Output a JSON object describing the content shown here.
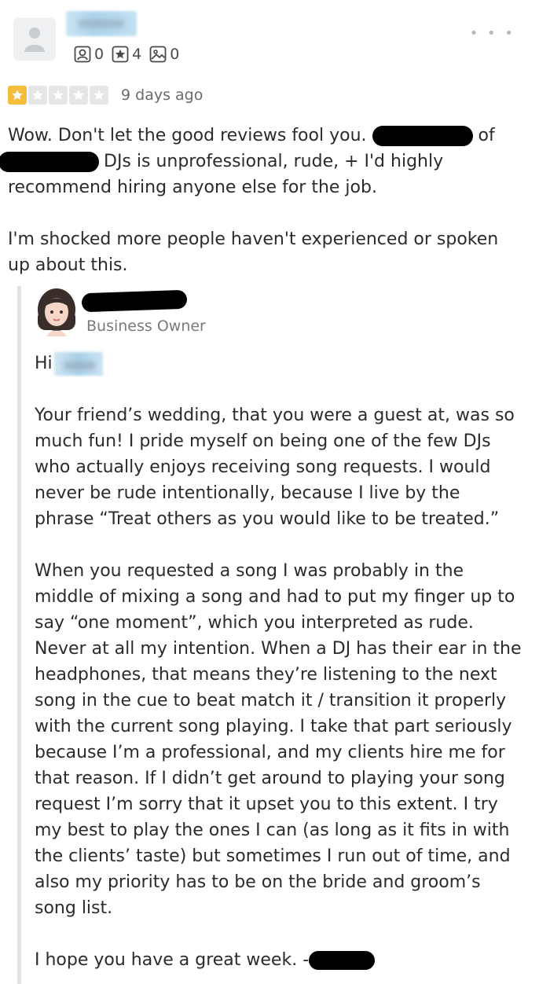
{
  "reviewer": {
    "stats": {
      "friends": "0",
      "reviews": "4",
      "photos": "0"
    },
    "more_menu": "• • •"
  },
  "review": {
    "rating": 1,
    "max_rating": 5,
    "date": "9 days ago",
    "line1a": "Wow. Don't let the good reviews fool you.",
    "line1b": "of",
    "line2": "DJs is unprofessional, rude, + I'd highly",
    "line3": "recommend hiring anyone else for the job.",
    "para2_line1": "I'm shocked more people haven't experienced or spoken",
    "para2_line2": "up about this."
  },
  "owner": {
    "role": "Business Owner",
    "greeting": "Hi",
    "para1": [
      "Your friend’s wedding, that you were a guest at, was so",
      "much fun! I pride myself on being one of the few DJs",
      "who actually enjoys receiving song requests. I would",
      "never be rude intentionally, because I live by the",
      "phrase “Treat others as you would like to be treated.”"
    ],
    "para2": [
      "When you requested a song I was probably in the",
      "middle of mixing a song and had to put my finger up to",
      "say “one moment”, which you interpreted as rude.",
      "Never at all my intention. When a DJ has their ear in the",
      "headphones, that means they’re listening to the next",
      "song in the cue to beat match it / transition it properly",
      "with the current song playing. I take that part seriously",
      "because I’m a professional, and my clients hire me for",
      "that reason. If I didn’t get around to playing your song",
      "request I’m sorry that it upset you to this extent. I try",
      "my best to play the ones I can (as long as it fits in with",
      "the clients’ taste)  but sometimes I run out of time, and",
      "also my priority has to be on the bride and groom’s",
      "song list."
    ],
    "closing": "I hope you have a great week. -"
  },
  "colors": {
    "star_on": "#f5bd3c",
    "star_off": "#e6e6e6",
    "rule": "#e3e3e3"
  }
}
